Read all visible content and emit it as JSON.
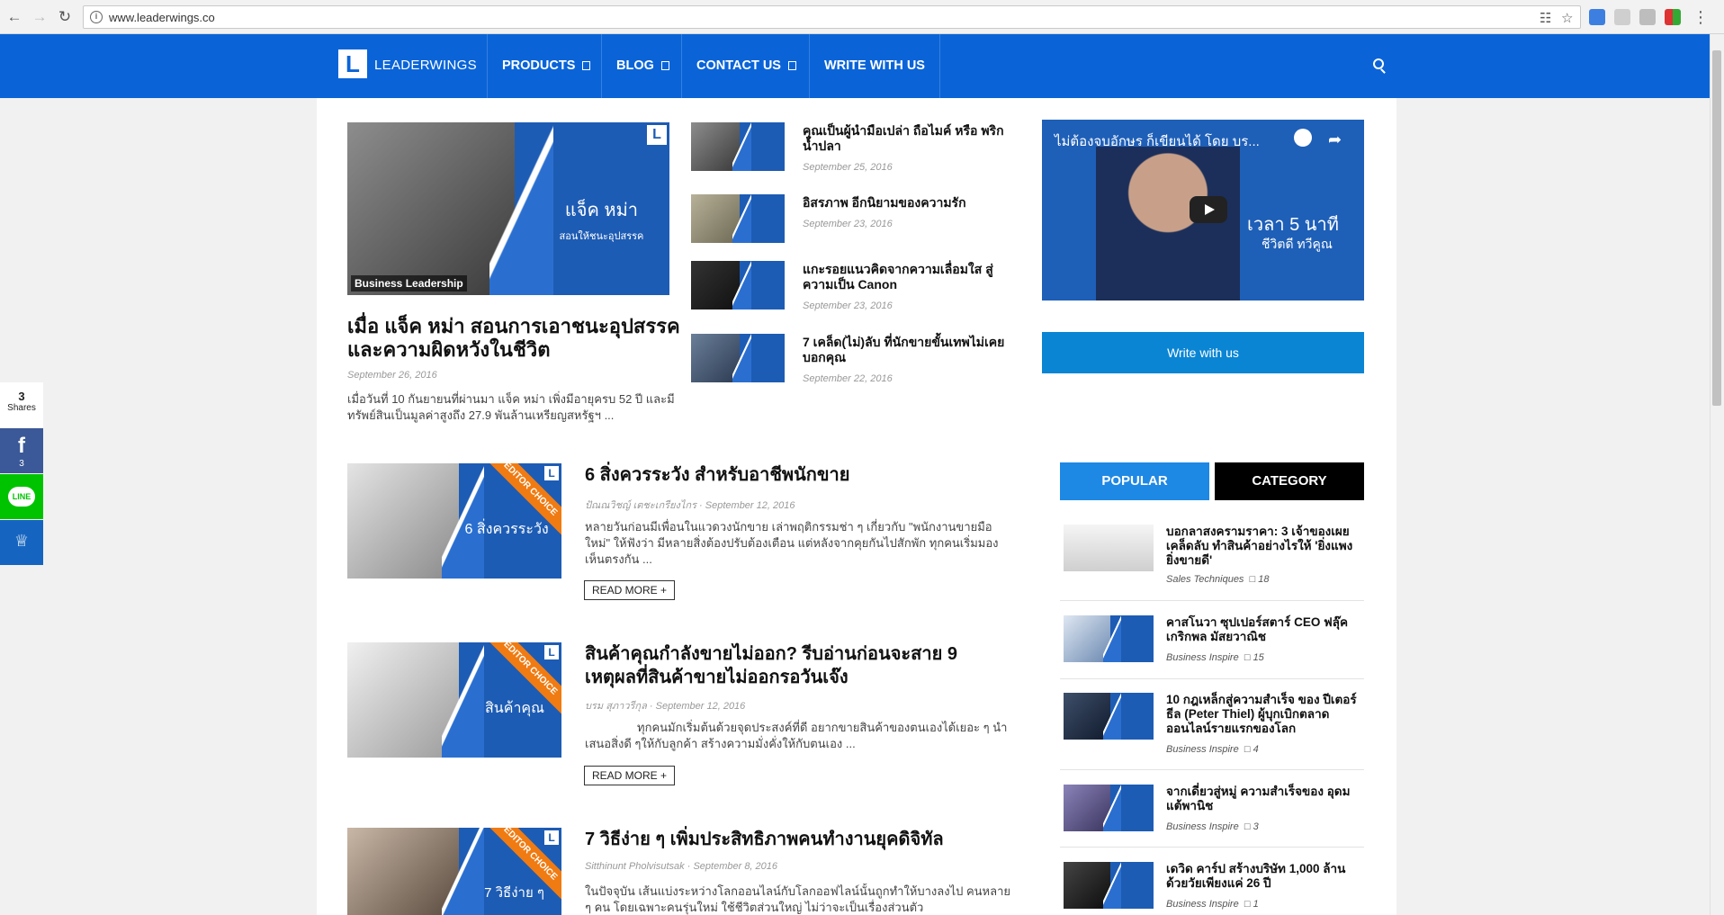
{
  "browser": {
    "url": "www.leaderwings.co"
  },
  "header": {
    "logo_letter": "L",
    "logo_text": "LEADERWINGS",
    "menu": [
      {
        "label": "PRODUCTS"
      },
      {
        "label": "BLOG"
      },
      {
        "label": "CONTACT US"
      },
      {
        "label": "WRITE WITH US"
      }
    ]
  },
  "featured": {
    "thumb_caption_1": "แจ็ค หม่า",
    "thumb_caption_2": "สอนให้ชนะอุปสรรค",
    "category": "Business Leadership",
    "title": "เมื่อ แจ็ค หม่า สอนการเอาชนะอุปสรรคและความผิดหวังในชีวิต",
    "date": "September 26, 2016",
    "excerpt": "เมื่อวันที่ 10 กันยายนที่ผ่านมา แจ็ค หม่า เพิ่งมีอายุครบ 52 ปี และมีทรัพย์สินเป็นมูลค่าสูงถึง 27.9 พันล้านเหรียญสหรัฐฯ ..."
  },
  "mini_posts": [
    {
      "title": "คุณเป็นผู้นำมือเปล่า ถือไมค์ หรือ พริกน้ำปลา",
      "date": "September 25, 2016"
    },
    {
      "title": "อิสรภาพ อีกนิยามของความรัก",
      "date": "September 23, 2016"
    },
    {
      "title": "แกะรอยแนวคิดจากความเลื่อมใส สู่ความเป็น Canon",
      "date": "September 23, 2016"
    },
    {
      "title": "7 เคล็ด(ไม่)ลับ ที่นักขายขั้นเทพไม่เคยบอกคุณ",
      "date": "September 22, 2016"
    }
  ],
  "video": {
    "title": "ไม่ต้องจบอักษร ก็เขียนได้ โดย บร...",
    "line1": "เวลา 5 นาที",
    "line2": "ชีวิตดี ทวีคูณ"
  },
  "write_button": "Write with us",
  "posts": [
    {
      "ribbon": "EDITOR CHOICE",
      "thumb_caption": "6 สิ่งควรระวัง",
      "title": "6 สิ่งควรระวัง สำหรับอาชีพนักขาย",
      "author": "ปัณณวิชญ์ เตชะเกรียงไกร",
      "date": "September 12, 2016",
      "excerpt": "หลายวันก่อนมีเพื่อนในแวดวงนักขาย เล่าพฤติกรรมช่า ๆ เกี่ยวกับ \"พนักงานขายมือใหม่\" ให้ฟังว่า มีหลายสิ่งต้องปรับต้องเตือน แต่หลังจากคุยกันไปสักพัก ทุกคนเริ่มมองเห็นตรงกัน ...",
      "read_more": "READ MORE +"
    },
    {
      "ribbon": "EDITOR CHOICE",
      "thumb_caption": "สินค้าคุณ",
      "title": "สินค้าคุณกำลังขายไม่ออก? รีบอ่านก่อนจะสาย 9 เหตุผลที่สินค้าขายไม่ออกรอวันเจ๊ง",
      "author": "บรม สุภาวรีกุล",
      "date": "September 12, 2016",
      "excerpt": "ทุกคนมักเริ่มต้นด้วยจุดประสงค์ที่ดี อยากขายสินค้าของตนเองได้เยอะ ๆ นำเสนอสิ่งดี ๆให้กับลูกค้า สร้างความมั่งคั่งให้กับตนเอง ...",
      "read_more": "READ MORE +"
    },
    {
      "ribbon": "EDITOR CHOICE",
      "thumb_caption": "7 วิธีง่าย ๆ",
      "title": "7 วิธีง่าย ๆ เพิ่มประสิทธิภาพคนทำงานยุคดิจิทัล",
      "author": "Sitthinunt Pholvisutsak",
      "date": "September 8, 2016",
      "excerpt": "ในปัจจุบัน เส้นแบ่งระหว่างโลกออนไลน์กับโลกออฟไลน์นั้นถูกทำให้บางลงไป คนหลาย ๆ คน โดยเฉพาะคนรุ่นใหม่ ใช้ชีวิตส่วนใหญ่ ไม่ว่าจะเป็นเรื่องส่วนตัว"
    }
  ],
  "sidebar": {
    "tabs": [
      {
        "label": "POPULAR"
      },
      {
        "label": "CATEGORY"
      }
    ],
    "items": [
      {
        "title": "บอกลาสงครามราคา: 3 เจ้าของเผยเคล็ดลับ ทำสินค้าอย่างไรให้ 'ยิ่งแพงยิ่งขายดี'",
        "category": "Sales Techniques",
        "count": "18"
      },
      {
        "title": "คาสโนวา ซุปเปอร์สตาร์ CEO ฟลุ๊ค เกริกพล มัสยวาณิช",
        "category": "Business Inspire",
        "count": "15"
      },
      {
        "title": "10 กฎเหล็กสู่ความสำเร็จ ของ ปีเตอร์ ธีล (Peter Thiel) ผู้บุกเบิกตลาดออนไลน์รายแรกของโลก",
        "category": "Business Inspire",
        "count": "4"
      },
      {
        "title": "จากเดี่ยวสู่หมู่ ความสำเร็จของ อุดม แต้พานิช",
        "category": "Business Inspire",
        "count": "3"
      },
      {
        "title": "เดวิด คาร์ป สร้างบริษัท 1,000 ล้านด้วยวัยเพียงแค่ 26 ปี",
        "category": "Business Inspire",
        "count": "1"
      }
    ]
  },
  "share": {
    "count": "3",
    "label": "Shares",
    "facebook_count": "3",
    "line_label": "LINE"
  },
  "colors": {
    "brand_blue": "#0a64d8",
    "ribbon_orange": "#f07b12",
    "write_blue": "#0a85d4",
    "tab_active": "#1e88e5"
  }
}
